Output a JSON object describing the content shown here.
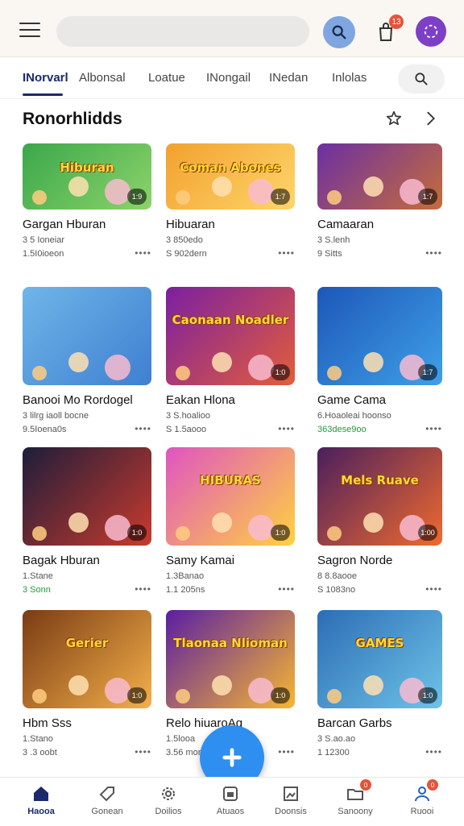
{
  "header": {
    "notification_count": "13",
    "icons": [
      "menu-icon",
      "search-icon",
      "shopping-bag-icon",
      "user-profile-icon"
    ]
  },
  "tabs": [
    {
      "label": "INorvarl",
      "active": true
    },
    {
      "label": "Albonsal"
    },
    {
      "label": "Loatue"
    },
    {
      "label": "INongail"
    },
    {
      "label": "INedan"
    },
    {
      "label": "Inlolas"
    }
  ],
  "section": {
    "title": "Ronorhlidds"
  },
  "cards": [
    {
      "title": "Gargan Hburan",
      "meta1": "3 5 Ioneiar",
      "meta2": "1.5I0ioeon",
      "badge": "1:9",
      "art_text": "Hiburan",
      "palette": [
        "#3aa84b",
        "#8dd36a"
      ]
    },
    {
      "title": "Hibuaran",
      "meta1": "3 850edo",
      "meta2": "S 902dern",
      "badge": "1:7",
      "art_text": "Coman Abones",
      "palette": [
        "#f2a12e",
        "#ffd56b"
      ]
    },
    {
      "title": "Camaaran",
      "meta1": "3 S.lenh",
      "meta2": "9 Sitts",
      "badge": "1:7",
      "art_text": "",
      "palette": [
        "#6b2fa3",
        "#c66d3a"
      ]
    },
    {
      "title": "Banooi Mo Rordogel",
      "meta1": "3 lilrg iaoll bocne",
      "meta2": "9.5Ioena0s",
      "badge": "",
      "art_text": "",
      "palette": [
        "#6fb6e8",
        "#3f7fd1"
      ]
    },
    {
      "title": "Eakan Hlona",
      "meta1": "3 S.hoalioo",
      "meta2": "S 1.5aooo",
      "badge": "1:0",
      "art_text": "Caonaan Noadler",
      "palette": [
        "#7b1fa2",
        "#e35d3a"
      ]
    },
    {
      "title": "Game Cama",
      "meta1": "6.Hoaoleai hoonso",
      "meta2": "363dese9oo",
      "meta2_green": true,
      "badge": "1:7",
      "art_text": "",
      "palette": [
        "#1d57b8",
        "#3fa0e8"
      ]
    },
    {
      "title": "Bagak Hburan",
      "meta1": "1.Stane",
      "meta2": "3 Sonn",
      "meta2_green": true,
      "badge": "1:0",
      "art_text": "",
      "palette": [
        "#1d1d3a",
        "#c93a2d"
      ]
    },
    {
      "title": "Samy Kamai",
      "meta1": "1.3Banao",
      "meta2": "1.1 205ns",
      "badge": "1:0",
      "art_text": "HIBURAS",
      "palette": [
        "#e054c3",
        "#ffd23f"
      ]
    },
    {
      "title": "Sagron Norde",
      "meta1": "8 8.8aooe",
      "meta2": "S 1083no",
      "badge": "1:00",
      "art_text": "Mels Ruave",
      "palette": [
        "#4a1f5e",
        "#f06a2e"
      ]
    },
    {
      "title": "Hbm Sss",
      "meta1": "1.Stano",
      "meta2": "3 .3 oobt",
      "badge": "1:0",
      "art_text": "Gerier",
      "palette": [
        "#7a3b14",
        "#f4b04a"
      ]
    },
    {
      "title": "Relo hiuaroAq",
      "meta1": "1.5looa",
      "meta2": "3.56 mor",
      "badge": "1:0",
      "art_text": "Tlaonaa Nlioman",
      "palette": [
        "#5a1ea3",
        "#f7b731"
      ]
    },
    {
      "title": "Barcan Garbs",
      "meta1": "3 S.ao.ao",
      "meta2": "1 12300",
      "badge": "1:0",
      "art_text": "GAMES",
      "palette": [
        "#2c6db5",
        "#6ec3e8"
      ]
    }
  ],
  "bottom_nav": [
    {
      "label": "Haooa",
      "icon": "home-icon",
      "active": true
    },
    {
      "label": "Gonean",
      "icon": "tag-icon"
    },
    {
      "label": "Doilios",
      "icon": "gear-icon"
    },
    {
      "label": "Atuaos",
      "icon": "gamepad-icon"
    },
    {
      "label": "Doonsis",
      "icon": "image-icon"
    },
    {
      "label": "Sanoony",
      "icon": "folder-icon",
      "badge": "0"
    },
    {
      "label": "Ruooi",
      "icon": "user-icon",
      "badge": "0"
    }
  ]
}
